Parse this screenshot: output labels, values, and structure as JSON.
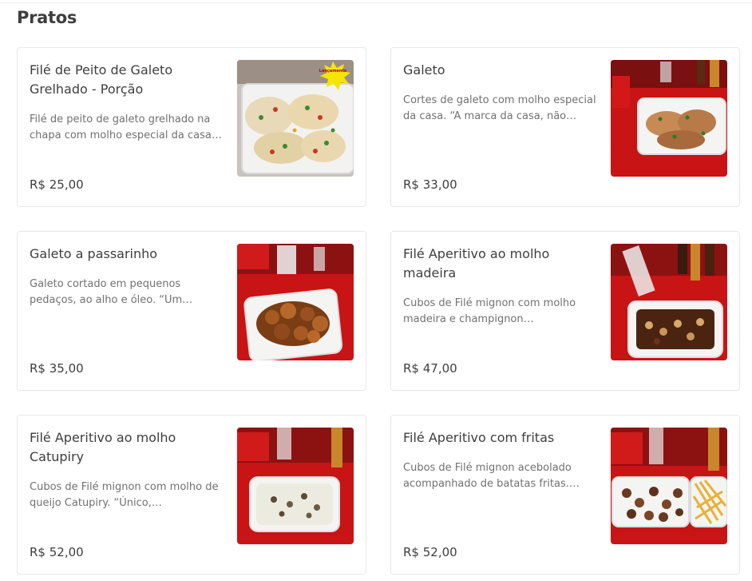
{
  "section": {
    "title": "Pratos"
  },
  "items": [
    {
      "name": "Filé de Peito de Galeto Grelhado - Porção",
      "description": "Filé de peito de galeto grelhado na chapa com molho especial da casa…",
      "price": "R$ 25,00",
      "badge": "Lançamento"
    },
    {
      "name": "Galeto",
      "description": "Cortes de galeto com molho especial da casa. “A marca da casa, não exist…",
      "price": "R$ 33,00"
    },
    {
      "name": "Galeto a passarinho",
      "description": "Galeto cortado em pequenos pedaços, ao alho e óleo. “Um…",
      "price": "R$ 35,00"
    },
    {
      "name": "Filé Aperitivo ao molho madeira",
      "description": "Cubos de Filé mignon com molho madeira e champignon…",
      "price": "R$ 47,00"
    },
    {
      "name": "Filé Aperitivo ao molho Catupiry",
      "description": "Cubos de Filé mignon com molho de queijo Catupiry. “Único, maravilhoso…",
      "price": "R$ 52,00"
    },
    {
      "name": "Filé Aperitivo com fritas",
      "description": "Cubos de Filé mignon acebolado acompanhado de batatas fritas.…",
      "price": "R$ 52,00"
    }
  ],
  "colors": {
    "tablecloth_red": "#c81414",
    "container_white": "#f4f4f2",
    "badge_yellow": "#f5e600"
  }
}
